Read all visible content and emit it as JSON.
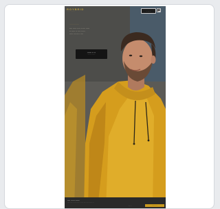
{
  "header": {
    "logo_text": "ROYBRID",
    "logo_subtext": "···········",
    "button_label": "· · · ·"
  },
  "hero": {
    "kicker": "··· ····· ······",
    "headline_lines": [
      "···· ····· ···· ······ ·····",
      "·· ····· ·· ···· ·····",
      "····· ········ ····"
    ],
    "cta_label": "······ ·· ··",
    "cta_sublabel": "···· ··· ······"
  },
  "cookie": {
    "title": "···· ······ ······",
    "text": "···· ····· ·· ····· ···· ·· ····· ···· ····· ······ ···",
    "settings_label": "·······",
    "accept_label": "······ ···"
  },
  "colors": {
    "page_bg": "#e9ebee",
    "accent_yellow": "#e0a91f",
    "dark": "#141414"
  }
}
